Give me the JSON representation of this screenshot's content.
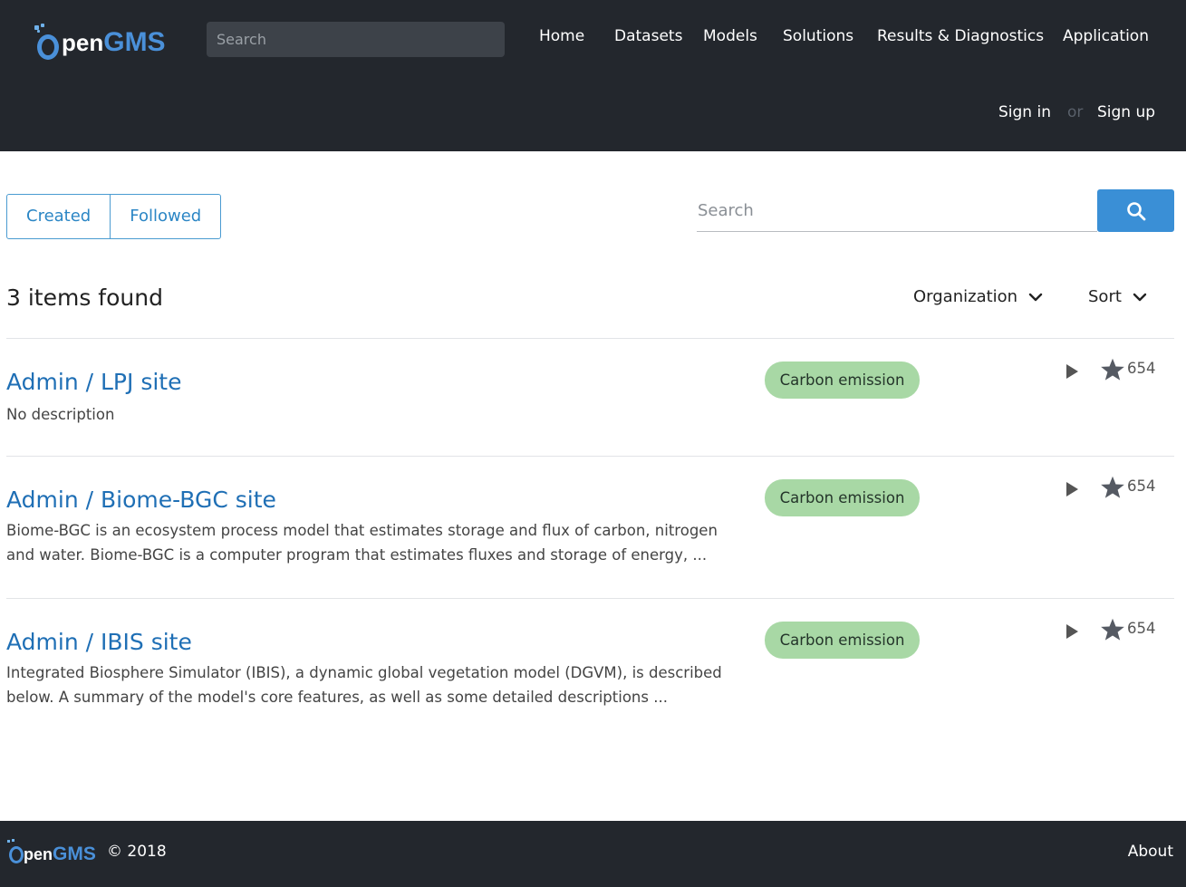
{
  "brand": {
    "logo_prefix": "pen",
    "logo_suffix": "GMS",
    "logo_alt": "OpenGMS",
    "primary_color": "#4a90d9"
  },
  "header": {
    "search_placeholder": "Search",
    "nav": [
      "Home",
      "Datasets",
      "Models",
      "Solutions",
      "Results & Diagnostics",
      "Application"
    ],
    "sign_in": "Sign in",
    "or": "or",
    "sign_up": "Sign up"
  },
  "tabs": {
    "created": "Created",
    "followed": "Followed"
  },
  "search": {
    "placeholder": "Search",
    "button_icon": "search-icon"
  },
  "results": {
    "count_label": "3 items found",
    "organization_label": "Organization",
    "sort_label": "Sort"
  },
  "items": [
    {
      "title": "Admin / LPJ site",
      "description": "No description",
      "tag": "Carbon emission",
      "stars": "654"
    },
    {
      "title": "Admin / Biome-BGC site",
      "description": "Biome-BGC is an ecosystem process model that estimates storage and flux of carbon, nitrogen and water. Biome-BGC is a computer program that estimates fluxes and storage of energy, ...",
      "tag": "Carbon emission",
      "stars": "654"
    },
    {
      "title": "Admin / IBIS site",
      "description": "Integrated Biosphere Simulator (IBIS), a dynamic global vegetation model (DGVM), is described below. A summary of the model's core features, as well as some detailed descriptions ...",
      "tag": "Carbon emission",
      "stars": "654"
    }
  ],
  "footer": {
    "copyright": "© 2018",
    "about": "About"
  },
  "colors": {
    "header_bg": "#23272d",
    "accent": "#3a8fd6",
    "link": "#1f6fb5",
    "badge_bg": "#a8d8a5"
  }
}
